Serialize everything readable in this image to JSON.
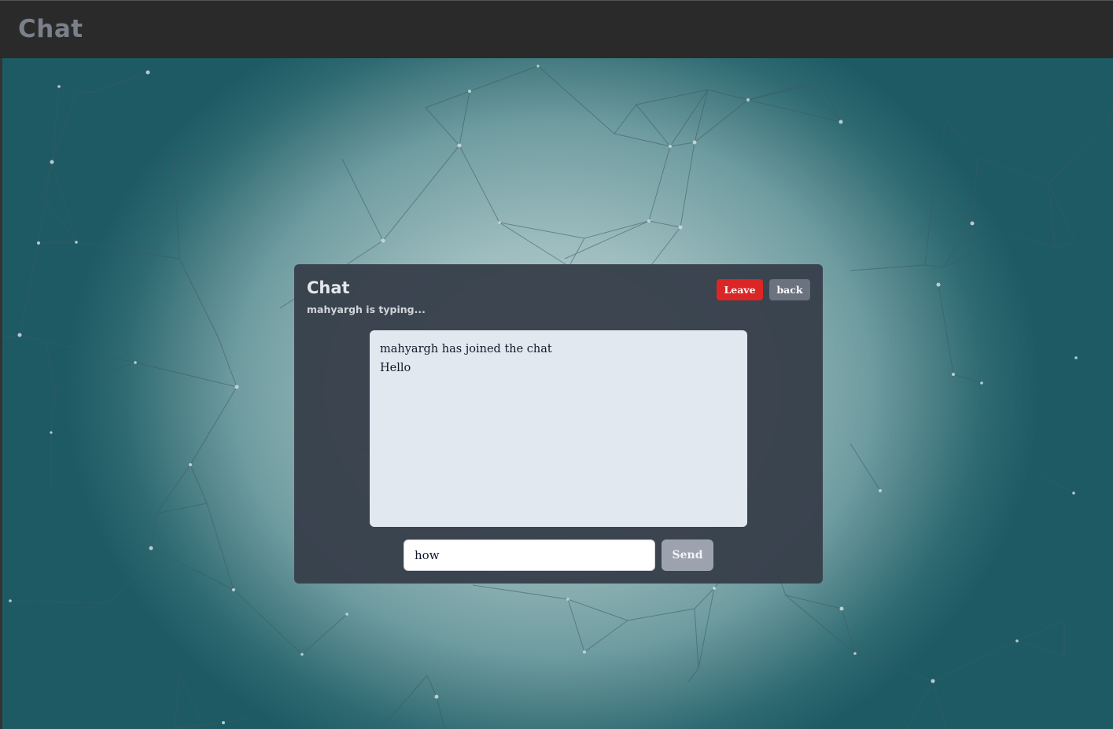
{
  "header": {
    "title": "Chat"
  },
  "chat": {
    "title": "Chat",
    "typing_status": "mahyargh is typing...",
    "leave_label": "Leave",
    "back_label": "back",
    "messages": [
      "mahyargh has joined the chat",
      "Hello"
    ],
    "input_value": "how",
    "send_label": "Send"
  },
  "colors": {
    "topbar_bg": "#2a2a2a",
    "card_bg": "#373f4b",
    "leave_button": "#dc2626",
    "back_button": "#6b7280",
    "send_button": "#9ca3af",
    "message_area_bg": "#e2e8f0"
  }
}
